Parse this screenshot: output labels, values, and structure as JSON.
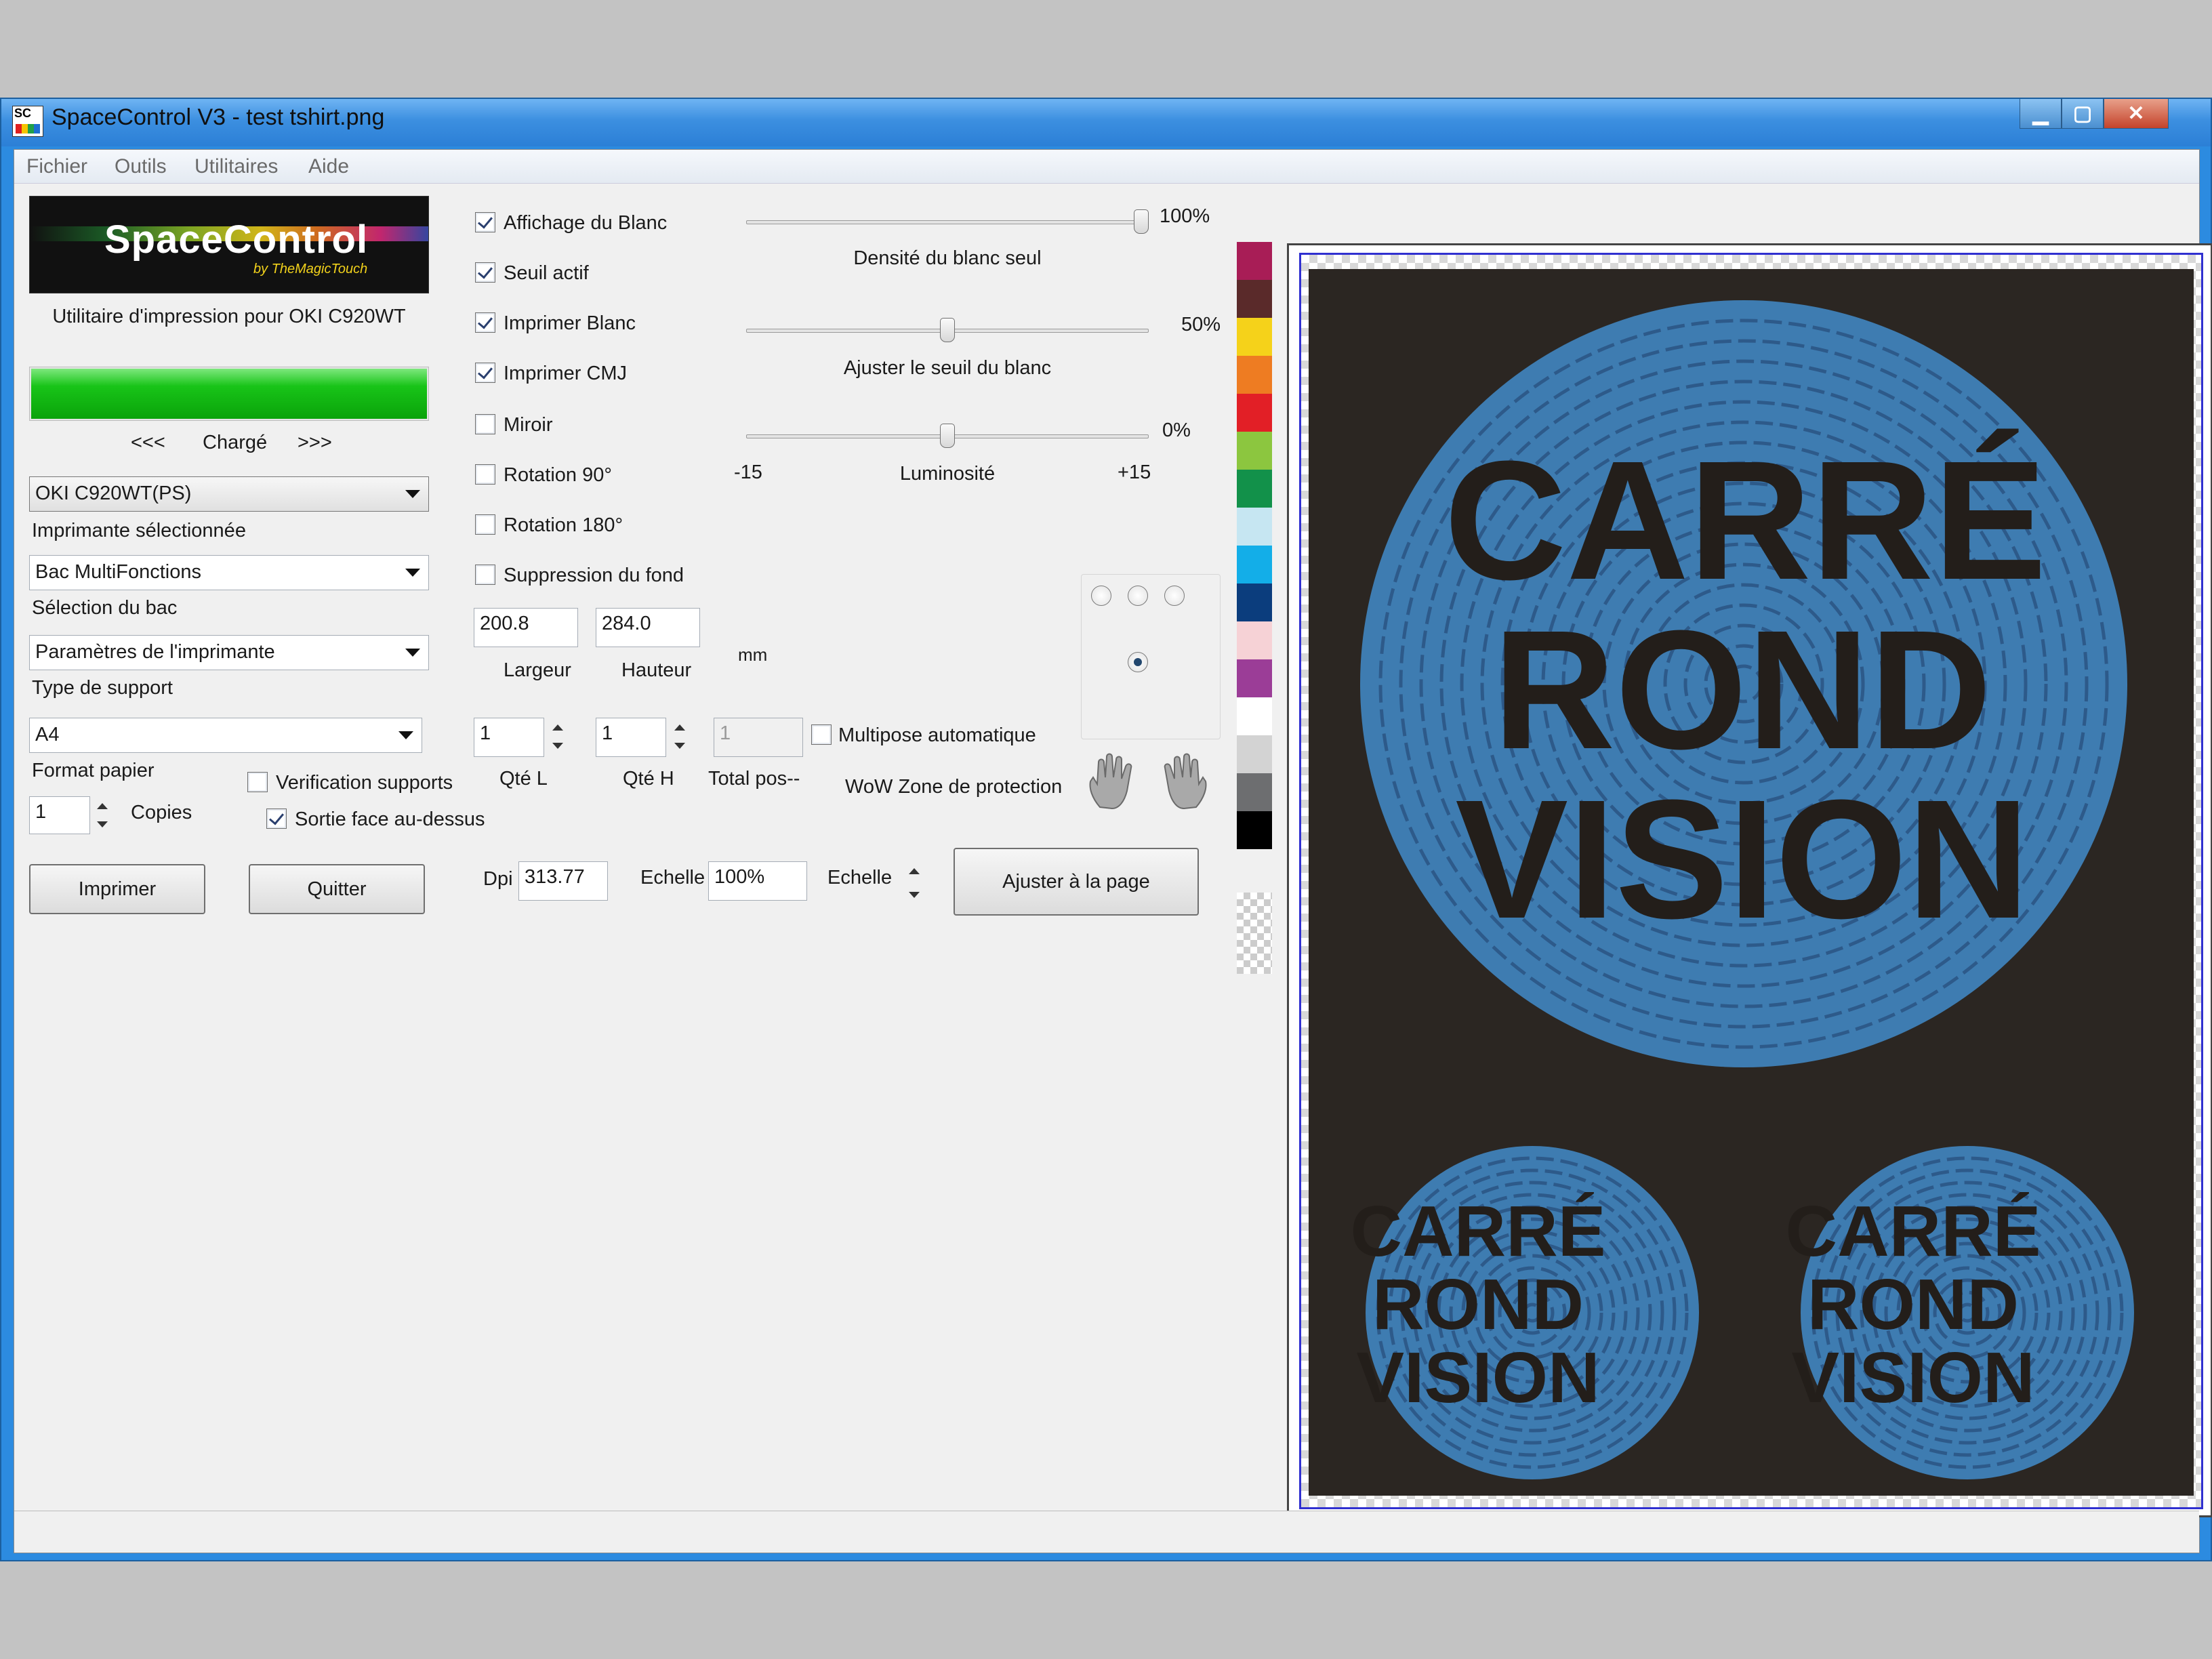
{
  "window": {
    "title": "SpaceControl V3 - test tshirt.png",
    "app_icon_text": "SC",
    "minimize_glyph": "▁",
    "maximize_glyph": "▢",
    "close_glyph": "✕"
  },
  "menu": [
    "Fichier",
    "Outils",
    "Utilitaires",
    "Aide"
  ],
  "left_panel": {
    "logo_text": "SpaceControl",
    "logo_subtext": "by TheMagicTouch",
    "subtitle": "Utilitaire d'impression pour OKI C920WT",
    "progress": 1.0,
    "progress_color": "#18c418",
    "nav_prev": "<<<",
    "status": "Chargé",
    "nav_next": ">>>",
    "printer": {
      "value": "OKI C920WT(PS)",
      "label": "Imprimante sélectionnée"
    },
    "tray": {
      "value": "Bac MultiFonctions",
      "label": "Sélection du bac"
    },
    "media": {
      "value": "Paramètres de l'imprimante",
      "label": "Type de support"
    },
    "paper": {
      "value": "A4",
      "label": "Format papier"
    },
    "copies": {
      "value": "1",
      "label": "Copies"
    },
    "verify_supports": {
      "label": "Verification supports",
      "checked": false
    },
    "face_up": {
      "label": "Sortie face au-dessus",
      "checked": true
    },
    "print_button": "Imprimer",
    "quit_button": "Quitter"
  },
  "options": [
    {
      "label": "Affichage du Blanc",
      "checked": true
    },
    {
      "label": "Seuil actif",
      "checked": true
    },
    {
      "label": "Imprimer Blanc",
      "checked": true
    },
    {
      "label": "Imprimer CMJ",
      "checked": true
    },
    {
      "label": "Miroir",
      "checked": false
    },
    {
      "label": "Rotation 90°",
      "checked": false
    },
    {
      "label": "Rotation 180°",
      "checked": false
    },
    {
      "label": "Suppression du fond",
      "checked": false
    }
  ],
  "sliders": {
    "white_density": {
      "value_text": "100%",
      "label": "Densité du blanc seul",
      "fraction": 1.0
    },
    "white_threshold": {
      "value_text": "50%",
      "label": "Ajuster le seuil du blanc",
      "fraction": 0.5
    },
    "brightness": {
      "value_text": "0%",
      "label": "Luminosité",
      "min": "-15",
      "max": "+15",
      "fraction": 0.5
    }
  },
  "size": {
    "width": "200.8",
    "height": "284.0",
    "width_label": "Largeur",
    "height_label": "Hauteur",
    "unit": "mm"
  },
  "quantity": {
    "qty_l": "1",
    "qty_h": "1",
    "total": "1",
    "qty_l_label": "Qté L",
    "qty_h_label": "Qté H",
    "total_label": "Total pos--",
    "auto_multipose": {
      "label": "Multipose automatique",
      "checked": false
    }
  },
  "protection_label": "WoW Zone de protection",
  "scale": {
    "dpi_label": "Dpi",
    "dpi_value": "313.77",
    "scale_label": "Echelle",
    "scale_value": "100%",
    "scale_label2": "Echelle",
    "fit_button": "Ajuster à la page"
  },
  "palette": [
    "#a81d56",
    "#5a2a2a",
    "#f5d21a",
    "#ee7c22",
    "#e21f26",
    "#8cc63f",
    "#12914a",
    "#c6e6f2",
    "#13aee8",
    "#0b3d7d",
    "#f6d2d6",
    "#9b3d97",
    "#ffffff",
    "#d3d3d3",
    "#6d6e70",
    "#000000"
  ],
  "artwork": {
    "background": "#2b2622",
    "circle_color": "#3e7cb1",
    "big_lines": [
      "CARRÉ",
      "ROND",
      "VISION"
    ],
    "small_lines": [
      "CARRÉ",
      "ROND",
      "VISION"
    ]
  }
}
